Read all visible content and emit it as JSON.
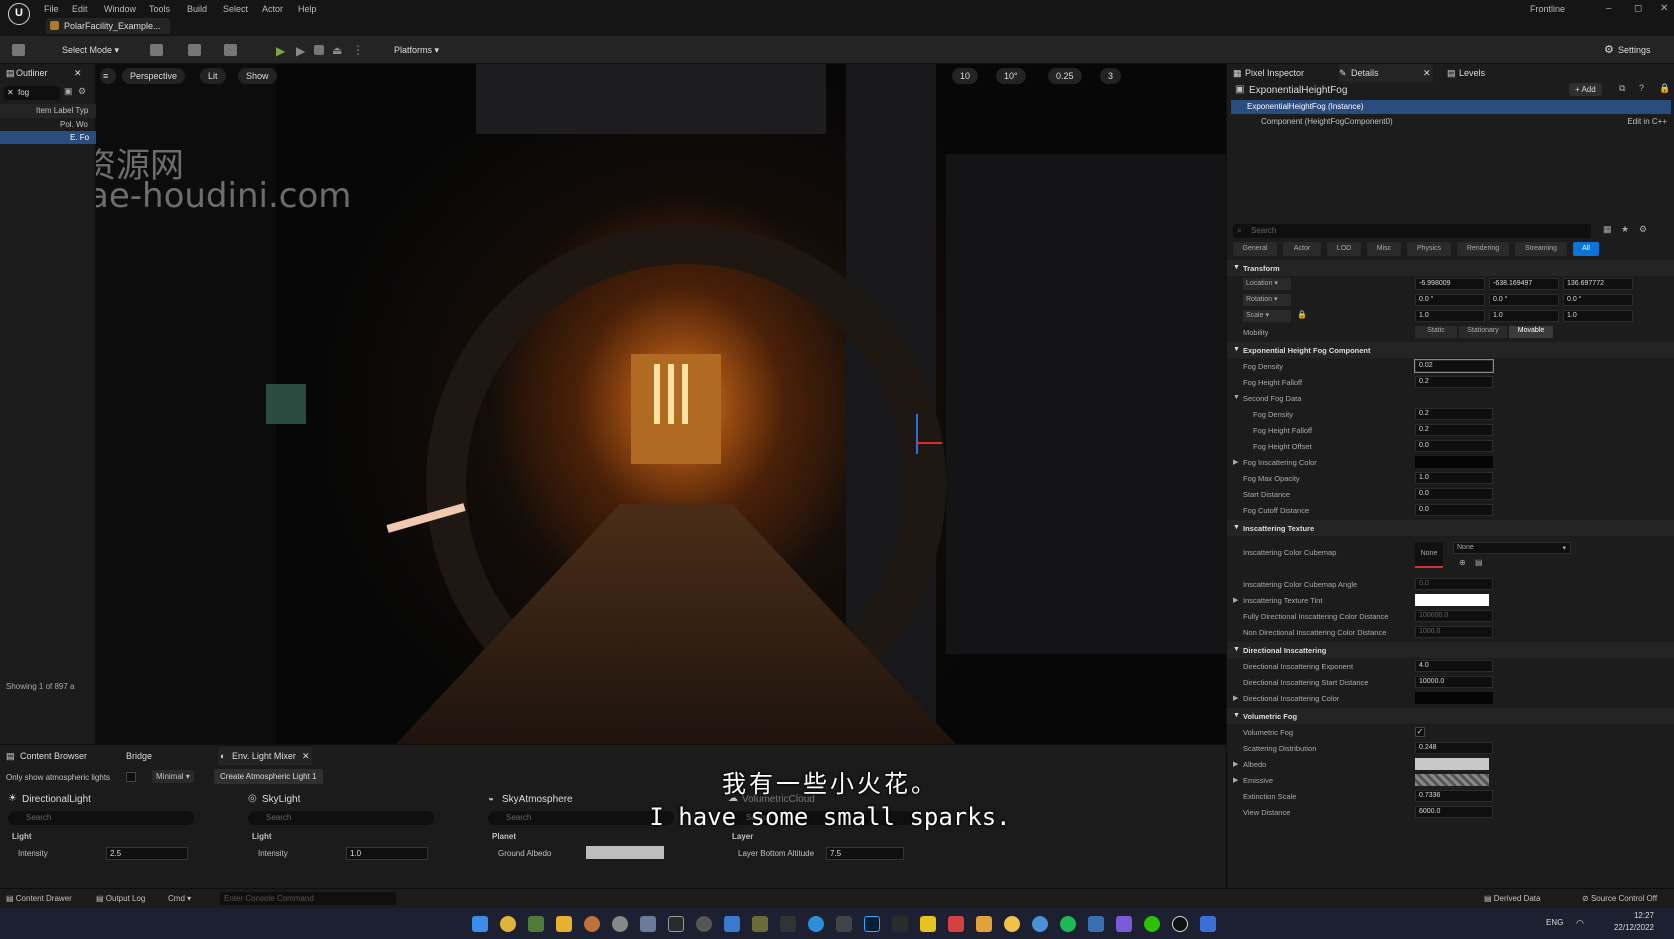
{
  "app": {
    "menus": [
      "File",
      "Edit",
      "Window",
      "Tools",
      "Build",
      "Select",
      "Actor",
      "Help"
    ],
    "project_tab": "PolarFacility_Example...",
    "session": "Frontline",
    "window_controls": [
      "–",
      "◻",
      "✕"
    ]
  },
  "toolbar": {
    "select_mode": "Select Mode",
    "platforms": "Platforms",
    "settings": "Settings"
  },
  "outliner": {
    "tab": "Outliner",
    "filter_value": "fog",
    "header": "Item Label  Typ",
    "row1": "Pol. Wo",
    "row2": "E. Fo",
    "status": "Showing 1 of 897 a"
  },
  "viewport": {
    "perspective": "Perspective",
    "lit": "Lit",
    "show": "Show",
    "grid_snap": "10",
    "angle_snap": "10°",
    "scale_snap": "0.25",
    "camera_speed": "3"
  },
  "watermark": {
    "line1": "资源网",
    "line2": "ae-houdini.com"
  },
  "subtitles": {
    "cn": "我有一些小火花。",
    "en": "I have some small sparks."
  },
  "bottom": {
    "tabs": [
      "Content Browser",
      "Bridge",
      "Env. Light Mixer"
    ],
    "only_show": "Only show atmospheric lights",
    "minimal": "Minimal",
    "create_btn": "Create Atmospheric Light 1",
    "search_placeholder": "Search",
    "columns": [
      {
        "title": "DirectionalLight",
        "section": "Light",
        "prop": "Intensity",
        "value": "2.5"
      },
      {
        "title": "SkyLight",
        "section": "Light",
        "prop": "Intensity",
        "value": "1.0"
      },
      {
        "title": "SkyAtmosphere",
        "section": "Planet",
        "prop": "Ground Albedo",
        "value": ""
      },
      {
        "title": "VolumetricCloud",
        "section": "Layer",
        "prop": "Layer Bottom Altitude",
        "value": "7.5"
      }
    ]
  },
  "details": {
    "tabs": [
      "Pixel Inspector",
      "Details",
      "Levels"
    ],
    "actor": "ExponentialHeightFog",
    "add_btn": "+ Add",
    "instance": "ExponentialHeightFog (Instance)",
    "component": "Component (HeightFogComponent0)",
    "edit_cpp": "Edit in C++",
    "search_placeholder": "Search",
    "filters": [
      "General",
      "Actor",
      "LOD",
      "Misc",
      "Physics",
      "Rendering",
      "Streaming",
      "All"
    ],
    "transform": {
      "title": "Transform",
      "location_label": "Location",
      "rotation_label": "Rotation",
      "scale_label": "Scale",
      "location": [
        "-6.998009",
        "-638.169497",
        "136.697772"
      ],
      "rotation": [
        "0.0 °",
        "0.0 °",
        "0.0 °"
      ],
      "scale": [
        "1.0",
        "1.0",
        "1.0"
      ],
      "mobility_label": "Mobility",
      "mobility": [
        "Static",
        "Stationary",
        "Movable"
      ]
    },
    "sections": {
      "fog_component": "Exponential Height Fog Component",
      "second_fog": "Second Fog Data",
      "inscatter_texture": "Inscattering Texture",
      "directional": "Directional Inscattering",
      "volumetric": "Volumetric Fog"
    },
    "props": {
      "fog_density": {
        "label": "Fog Density",
        "value": "0.02"
      },
      "fog_height_falloff": {
        "label": "Fog Height Falloff",
        "value": "0.2"
      },
      "second_fog_density": {
        "label": "Fog Density",
        "value": "0.2"
      },
      "second_height_falloff": {
        "label": "Fog Height Falloff",
        "value": "0.2"
      },
      "second_height_offset": {
        "label": "Fog Height Offset",
        "value": "0.0"
      },
      "fog_inscatter_color": {
        "label": "Fog Inscattering Color"
      },
      "fog_max_opacity": {
        "label": "Fog Max Opacity",
        "value": "1.0"
      },
      "start_distance": {
        "label": "Start Distance",
        "value": "0.0"
      },
      "fog_cutoff": {
        "label": "Fog Cutoff Distance",
        "value": "0.0"
      },
      "cubemap": {
        "label": "Inscattering Color Cubemap",
        "none_thumb": "None",
        "none_drop": "None"
      },
      "cubemap_angle": {
        "label": "Inscattering Color Cubemap Angle",
        "value": "0.0"
      },
      "texture_tint": {
        "label": "Inscattering Texture Tint"
      },
      "fully_dir": {
        "label": "Fully Directional Inscattering Color Distance",
        "value": "100000.0"
      },
      "non_dir": {
        "label": "Non Directional Inscattering Color Distance",
        "value": "1000.0"
      },
      "dir_exponent": {
        "label": "Directional Inscattering Exponent",
        "value": "4.0"
      },
      "dir_start": {
        "label": "Directional Inscattering Start Distance",
        "value": "10000.0"
      },
      "dir_color": {
        "label": "Directional Inscattering Color"
      },
      "vol_fog": {
        "label": "Volumetric Fog"
      },
      "scat_dist": {
        "label": "Scattering Distribution",
        "value": "0.248"
      },
      "albedo": {
        "label": "Albedo"
      },
      "emissive": {
        "label": "Emissive"
      },
      "extinction": {
        "label": "Extinction Scale",
        "value": "0.7336"
      },
      "view_distance": {
        "label": "View Distance",
        "value": "6000.0"
      }
    }
  },
  "statusbar": {
    "content_drawer": "Content Drawer",
    "output_log": "Output Log",
    "cmd": "Cmd",
    "console_placeholder": "Enter Console Command",
    "derived": "Derived Data",
    "source": "Source Control Off"
  },
  "taskbar": {
    "lang": "ENG",
    "time": "12:27",
    "date": "22/12/2022"
  },
  "colors": {
    "accent": "#0a74d8",
    "selection": "#2b4c7e",
    "panel": "#1c1c1c"
  }
}
